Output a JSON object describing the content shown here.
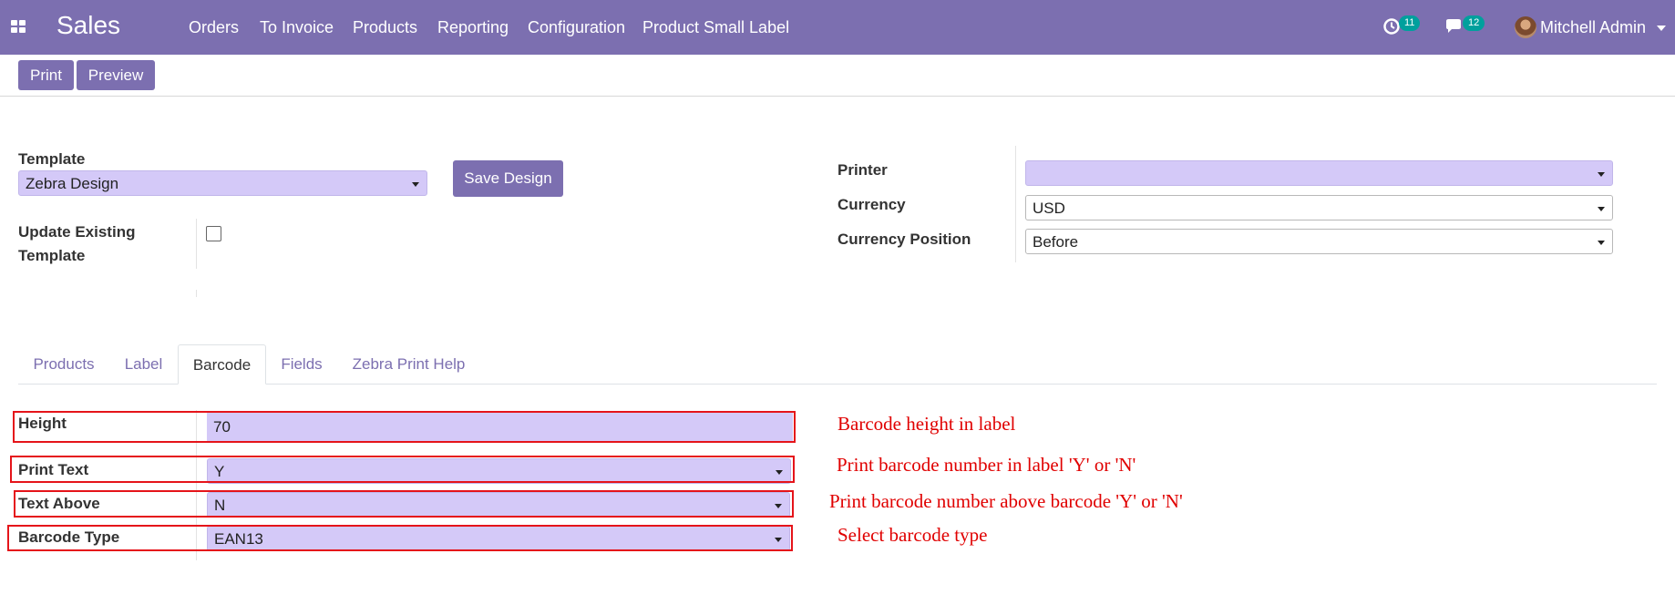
{
  "navbar": {
    "app_title": "Sales",
    "menu": [
      "Orders",
      "To Invoice",
      "Products",
      "Reporting",
      "Configuration",
      "Product Small Label"
    ],
    "activity_count": "11",
    "message_count": "12",
    "user_name": "Mitchell Admin",
    "bg_color": "#7c6fb0"
  },
  "toolbar": {
    "print_label": "Print",
    "preview_label": "Preview"
  },
  "form": {
    "template_label": "Template",
    "template_value": "Zebra Design",
    "save_design_label": "Save Design",
    "update_existing_label_1": "Update Existing",
    "update_existing_label_2": "Template",
    "update_existing_checked": false,
    "printer_label": "Printer",
    "printer_value": "",
    "currency_label": "Currency",
    "currency_value": "USD",
    "currency_position_label": "Currency Position",
    "currency_position_value": "Before"
  },
  "tabs": [
    {
      "label": "Products",
      "active": false
    },
    {
      "label": "Label",
      "active": false
    },
    {
      "label": "Barcode",
      "active": true
    },
    {
      "label": "Fields",
      "active": false
    },
    {
      "label": "Zebra Print Help",
      "active": false
    }
  ],
  "barcode": {
    "height_label": "Height",
    "height_value": "70",
    "print_text_label": "Print Text",
    "print_text_value": "Y",
    "text_above_label": "Text Above",
    "text_above_value": "N",
    "barcode_type_label": "Barcode Type",
    "barcode_type_value": "EAN13"
  },
  "annotations": {
    "height": "Barcode height in label",
    "print_text": "Print barcode number in label 'Y' or 'N'",
    "text_above": "Print barcode number above barcode 'Y' or 'N'",
    "barcode_type": "Select barcode type",
    "color": "#e5141a"
  }
}
